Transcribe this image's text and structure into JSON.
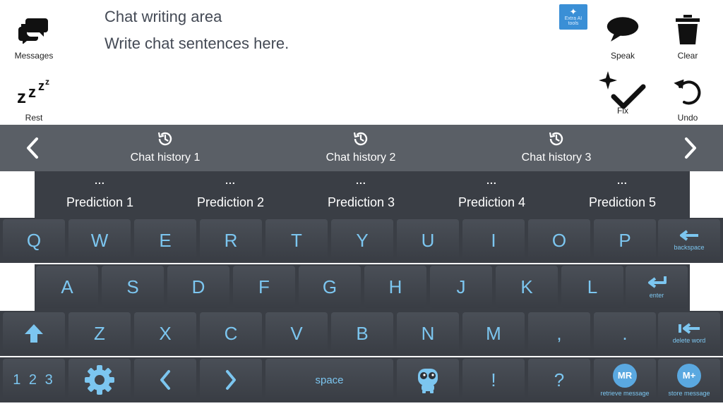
{
  "top": {
    "messages_label": "Messages",
    "rest_label": "Rest",
    "speak_label": "Speak",
    "clear_label": "Clear",
    "fix_label": "Fix",
    "undo_label": "Undo",
    "extra_ai_label": "Extra AI tools"
  },
  "chat": {
    "title": "Chat writing area",
    "text": "Write chat sentences here."
  },
  "history": {
    "items": [
      "Chat history 1",
      "Chat history 2",
      "Chat history 3"
    ],
    "prev_icon": "chevron-left-icon",
    "next_icon": "chevron-right-icon"
  },
  "predictions": {
    "dots": "...",
    "items": [
      "Prediction 1",
      "Prediction 2",
      "Prediction 3",
      "Prediction 4",
      "Prediction 5"
    ]
  },
  "keyboard": {
    "row1": [
      "Q",
      "W",
      "E",
      "R",
      "T",
      "Y",
      "U",
      "I",
      "O",
      "P"
    ],
    "row2": [
      "A",
      "S",
      "D",
      "F",
      "G",
      "H",
      "J",
      "K",
      "L"
    ],
    "row3": [
      "Z",
      "X",
      "C",
      "V",
      "B",
      "N",
      "M",
      ",",
      "."
    ],
    "backspace_label": "backspace",
    "enter_label": "enter",
    "delete_word_label": "delete word",
    "numbers_label": "1 2 3",
    "space_label": "space",
    "question_label": "?",
    "exclaim_label": "!",
    "retrieve_label": "retrieve message",
    "retrieve_badge": "MR",
    "store_label": "store message",
    "store_badge": "M+"
  },
  "colors": {
    "accent": "#7cc6f0",
    "key_bg": "#44484f",
    "bar_bg": "#5a5f66",
    "prediction_bg": "#3a3e45",
    "badge": "#5aa8e0"
  }
}
